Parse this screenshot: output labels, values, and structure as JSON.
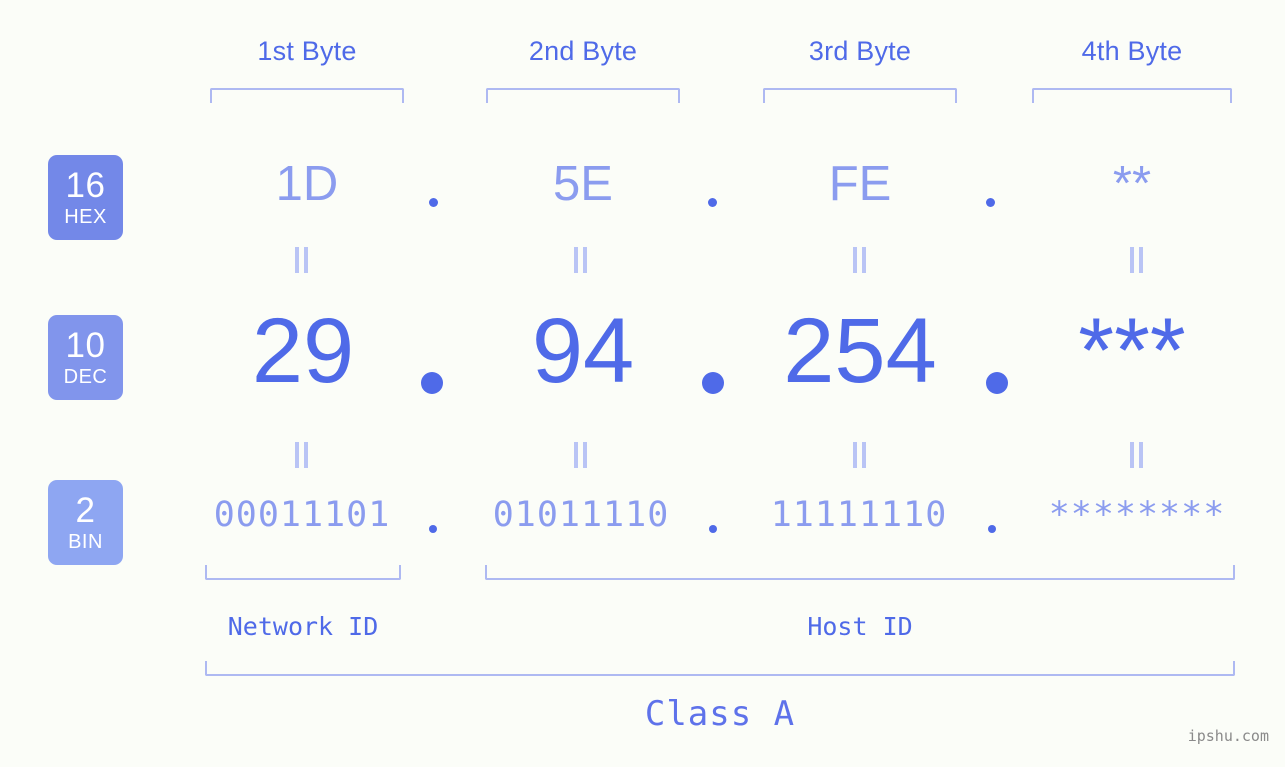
{
  "header": {
    "byte_labels": [
      "1st Byte",
      "2nd Byte",
      "3rd Byte",
      "4th Byte"
    ]
  },
  "bases": [
    {
      "num": "16",
      "name": "HEX",
      "color": "#7388e8"
    },
    {
      "num": "10",
      "name": "DEC",
      "color": "#8195ec"
    },
    {
      "num": "2",
      "name": "BIN",
      "color": "#8ea6f2"
    }
  ],
  "rows": {
    "hex": {
      "values": [
        "1D",
        "5E",
        "FE",
        "**"
      ],
      "separator": "."
    },
    "dec": {
      "values": [
        "29",
        "94",
        "254",
        "***"
      ],
      "separator": "."
    },
    "bin": {
      "values": [
        "00011101",
        "01011110",
        "11111110",
        "********"
      ],
      "separator": "."
    }
  },
  "equality_mark": "||",
  "footer": {
    "network_id_label": "Network ID",
    "host_id_label": "Host ID",
    "class_label": "Class A",
    "watermark": "ipshu.com"
  },
  "colors": {
    "background": "#fbfdf8",
    "accent_strong": "#4f6ae8",
    "accent_light": "#8b9cef",
    "bracket": "#aeb9f2",
    "equals": "#b9c4f5",
    "watermark": "#8a8a8a"
  }
}
